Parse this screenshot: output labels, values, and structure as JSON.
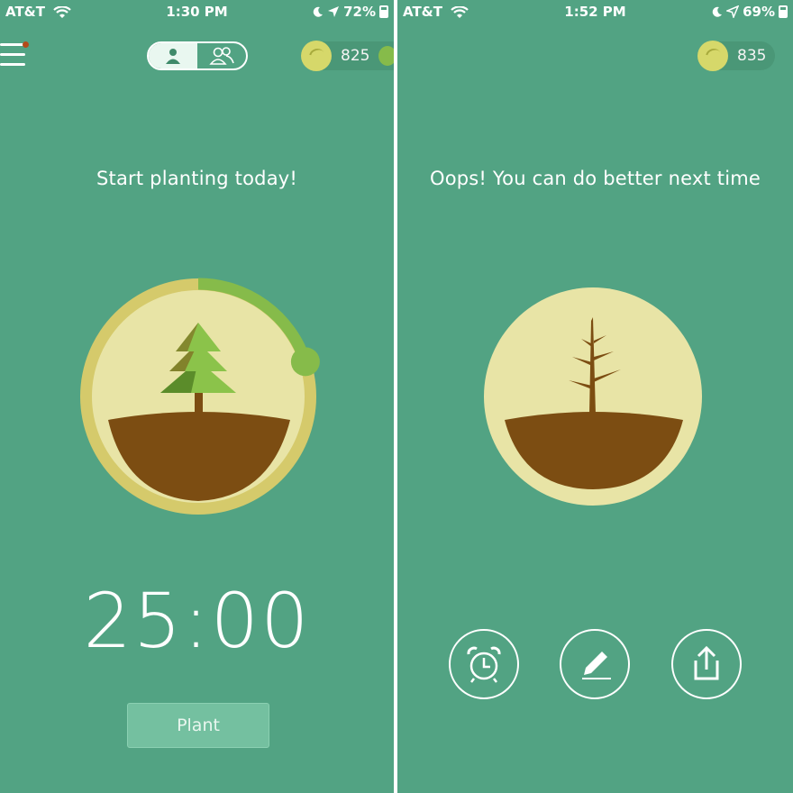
{
  "left": {
    "status": {
      "carrier": "AT&T",
      "time": "1:30 PM",
      "battery": "72%",
      "battery_level": 0.72
    },
    "coins": "825",
    "headline": "Start planting today!",
    "timer": "25:00",
    "plant_button": "Plant",
    "progress_fraction": 0.2
  },
  "right": {
    "status": {
      "carrier": "AT&T",
      "time": "1:52 PM",
      "battery": "69%",
      "battery_level": 0.69
    },
    "coins": "835",
    "headline": "Oops! You can do better next time"
  },
  "colors": {
    "background": "#52a383",
    "circle_fill": "#e8e4a6",
    "ring": "#d5ca6b",
    "progress": "#86bb4a",
    "soil": "#7c4d12",
    "tree_light": "#7cb342",
    "tree_dark": "#5b8c2a"
  }
}
